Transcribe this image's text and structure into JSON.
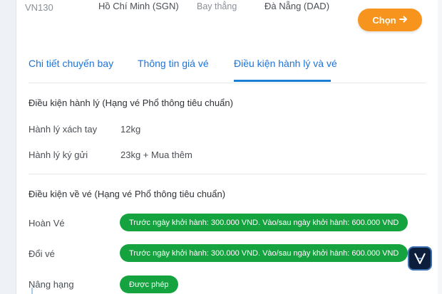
{
  "flight": {
    "code": "VN130",
    "from": "Hồ Chí Minh (SGN)",
    "type": "Bay thẳng",
    "to": "Đà Nẵng (DAD)",
    "choose_label": "Chọn"
  },
  "tabs": [
    {
      "label": "Chi tiết chuyến bay",
      "active": false
    },
    {
      "label": "Thông tin giá vé",
      "active": false
    },
    {
      "label": "Điều kiện hành lý và vé",
      "active": true
    }
  ],
  "baggage": {
    "title": "Điều kiện hành lý (Hạng vé Phổ thông tiêu chuẩn)",
    "rows": [
      {
        "label": "Hành lý xách tay",
        "value": "12kg"
      },
      {
        "label": "Hành lý ký gửi",
        "value": "23kg + Mua thêm"
      }
    ]
  },
  "ticket": {
    "title": "Điều kiện về vé (Hạng vé Phổ thông tiêu chuẩn)",
    "rows": [
      {
        "label": "Hoàn Vé",
        "value": "Trước ngày khởi hành: 300.000 VND. Vào/sau ngày khởi hành: 600.000 VND"
      },
      {
        "label": "Đổi vé",
        "value": "Trước ngày khởi hành: 300.000 VND. Vào/sau ngày khởi hành: 600.000 VND"
      },
      {
        "label": "Nâng hạng",
        "value": "Được phép"
      }
    ]
  },
  "colors": {
    "accent_orange": "#f7941d",
    "tab_blue": "#1e73d8",
    "pill_green": "#14a33e"
  },
  "icons": {
    "choose_arrow": "arrow-right-icon",
    "chat_widget": "chat-widget-icon"
  }
}
